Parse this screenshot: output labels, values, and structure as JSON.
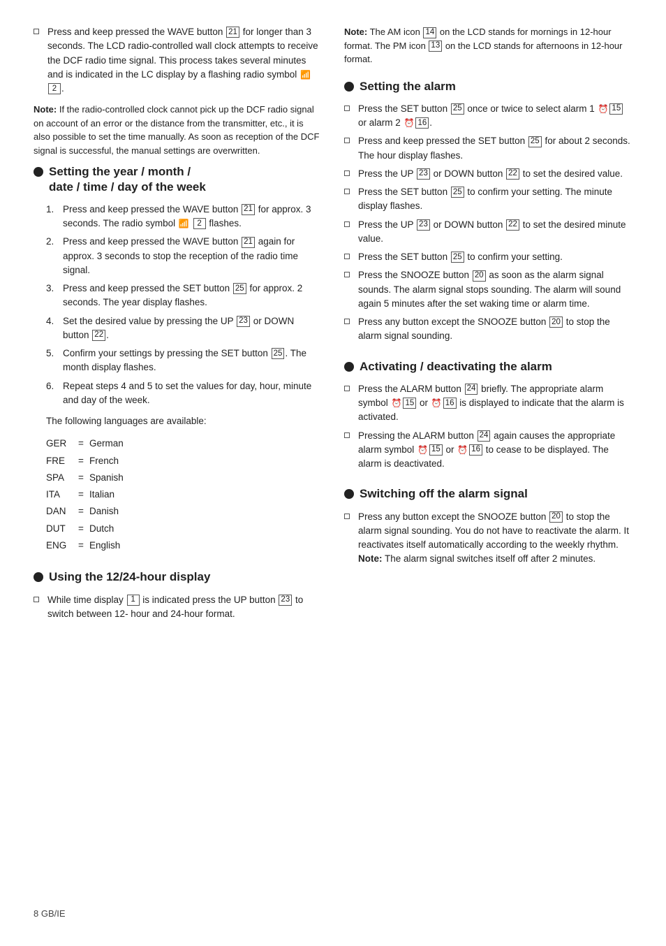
{
  "page": {
    "footer": "8    GB/IE"
  },
  "left": {
    "intro_para1": "Press and keep pressed the WAVE button",
    "intro_btn_wave": "21",
    "intro_para1b": "for longer than 3 seconds. The LCD radio-controlled wall clock attempts to receive the DCF radio time signal. This process takes several minutes and is indicated in the LC display by a flashing radio symbol",
    "intro_radio_icon": "2",
    "note_label": "Note:",
    "note_text": " If the radio-controlled clock cannot pick up the DCF radio signal on account of an error or the distance from the transmitter, etc., it is also possible to set the time manually. As soon as reception of the DCF signal is successful, the manual settings are overwritten.",
    "section1_heading": "Setting the year / month / date / time / day of the week",
    "section1_items": [
      {
        "text": "Press and keep pressed the WAVE button",
        "btn": "21",
        "text2": "for approx. 3 seconds. The radio symbol",
        "icon": "radio",
        "btn2": "2",
        "text3": "flashes."
      },
      {
        "text": "Press and keep pressed the WAVE button",
        "btn": "21",
        "text2": "again for approx. 3 seconds to stop the reception of the radio time signal."
      },
      {
        "text": "Press and keep pressed the SET button",
        "btn": "25",
        "text2": "for approx. 2 seconds. The year display flashes."
      },
      {
        "text": "Set the desired value by pressing the UP",
        "btn": "23",
        "text2": "or DOWN button",
        "btn2": "22",
        "text3": "."
      },
      {
        "text": "Confirm your settings by pressing the SET button",
        "btn": "25",
        "text2": ". The month display flashes."
      },
      {
        "text": "Repeat steps 4 and 5 to set the values for day, hour, minute and day of the week."
      }
    ],
    "lang_intro": "The following languages are available:",
    "languages": [
      {
        "abbr": "GER",
        "eq": "=",
        "name": "German"
      },
      {
        "abbr": "FRE",
        "eq": "=",
        "name": "French"
      },
      {
        "abbr": "SPA",
        "eq": "=",
        "name": "Spanish"
      },
      {
        "abbr": "ITA",
        "eq": "=",
        "name": "Italian"
      },
      {
        "abbr": "DAN",
        "eq": "=",
        "name": "Danish"
      },
      {
        "abbr": "DUT",
        "eq": "=",
        "name": "Dutch"
      },
      {
        "abbr": "ENG",
        "eq": "=",
        "name": "English"
      }
    ],
    "section2_heading": "Using the 12/24-hour display",
    "section2_items": [
      {
        "text": "While time display",
        "btn": "1",
        "text2": "is indicated press the UP button",
        "btn2": "23",
        "text3": "to switch between 12- hour and 24-hour format."
      }
    ]
  },
  "right": {
    "note_label": "Note:",
    "note_text_am": " The AM icon",
    "note_btn_am": "14",
    "note_text_am2": "on the LCD stands for mornings in 12-hour format. The PM icon",
    "note_btn_pm": "13",
    "note_text_pm2": "on the LCD stands for afternoons in 12-hour format.",
    "section3_heading": "Setting the alarm",
    "section3_items": [
      {
        "text": "Press the SET button",
        "btn": "25",
        "text2": "once or twice to select alarm 1",
        "icon1": "alarm",
        "btn1": "15",
        "text3": "or alarm 2",
        "icon2": "alarm",
        "btn2": "16",
        "text4": "."
      },
      {
        "text": "Press and keep pressed the SET button",
        "btn": "25",
        "text2": "for about 2 seconds. The hour display flashes."
      },
      {
        "text": "Press the UP",
        "btn": "23",
        "text2": "or DOWN button",
        "btn2": "22",
        "text3": "to set the desired value."
      },
      {
        "text": "Press the SET button",
        "btn": "25",
        "text2": "to confirm your setting. The minute display flashes."
      },
      {
        "text": "Press the UP",
        "btn": "23",
        "text2": "or DOWN button",
        "btn2": "22",
        "text3": "to set the desired minute value."
      },
      {
        "text": "Press the SET button",
        "btn": "25",
        "text2": "to confirm your setting."
      },
      {
        "text": "Press the SNOOZE button",
        "btn": "20",
        "text2": "as soon as the alarm signal sounds. The alarm signal stops sounding. The alarm will sound again 5 minutes after the set waking time or alarm time."
      },
      {
        "text": "Press any button except the SNOOZE button",
        "btn": "20",
        "text2": "to stop the alarm signal sounding."
      }
    ],
    "section4_heading": "Activating / deactivating the alarm",
    "section4_items": [
      {
        "text": "Press the ALARM button",
        "btn": "24",
        "text2": "briefly. The appropriate alarm symbol",
        "icon1": "alarm",
        "btn1": "15",
        "text3": "or",
        "icon2": "alarm",
        "btn2": "16",
        "text4": "is displayed to indicate that the alarm is activated."
      },
      {
        "text": "Pressing the ALARM button",
        "btn": "24",
        "text2": "again causes the appropriate alarm symbol",
        "icon1": "alarm",
        "btn1": "15",
        "text3": "or",
        "icon2": "alarm",
        "btn2": "16",
        "text4": "to cease to be displayed. The alarm is deactivated."
      }
    ],
    "section5_heading": "Switching off the alarm signal",
    "section5_items": [
      {
        "text": "Press any button except the SNOOZE button",
        "btn": "20",
        "text2": "to stop the alarm signal sounding. You do not have to reactivate the alarm. It reactivates itself automatically according to the weekly rhythm.",
        "note_label": "Note:",
        "note_text": " The alarm signal switches itself off after 2 minutes."
      }
    ]
  }
}
